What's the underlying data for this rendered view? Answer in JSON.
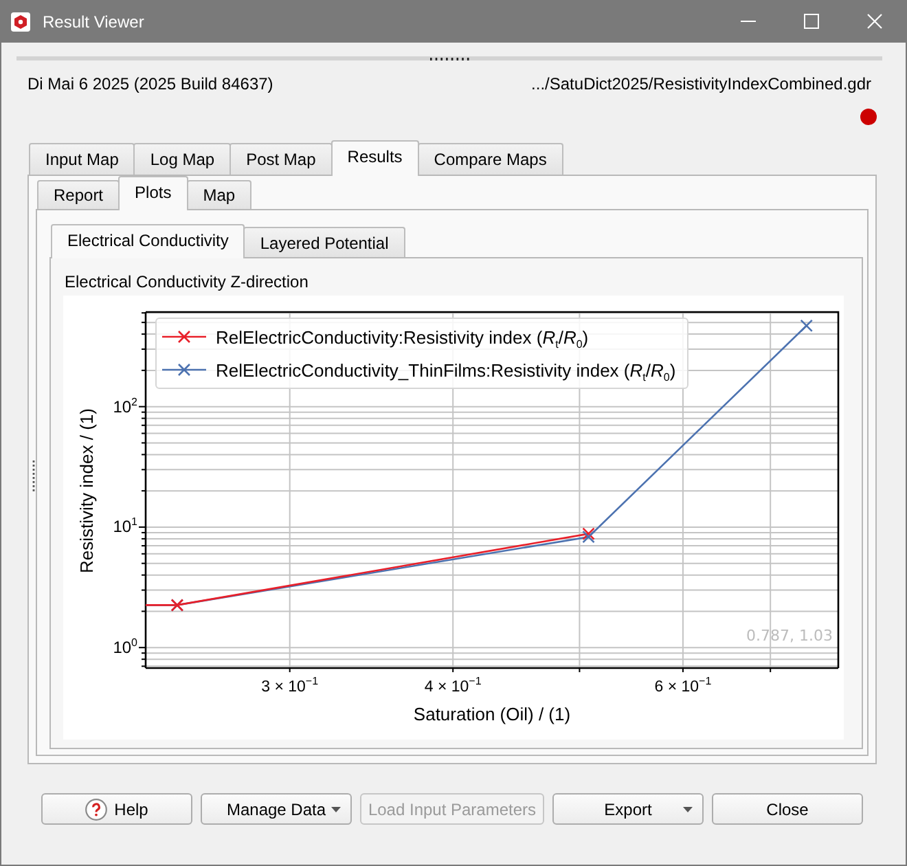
{
  "window": {
    "title": "Result Viewer"
  },
  "header": {
    "build_info": "Di Mai 6 2025 (2025 Build 84637)",
    "file_path": ".../SatuDict2025/ResistivityIndexCombined.gdr"
  },
  "main_tabs": [
    {
      "label": "Input Map",
      "selected": false
    },
    {
      "label": "Log Map",
      "selected": false
    },
    {
      "label": "Post Map",
      "selected": false
    },
    {
      "label": "Results",
      "selected": true
    },
    {
      "label": "Compare Maps",
      "selected": false
    }
  ],
  "sub_tabs": [
    {
      "label": "Report",
      "selected": false
    },
    {
      "label": "Plots",
      "selected": true
    },
    {
      "label": "Map",
      "selected": false
    }
  ],
  "plot_tabs": [
    {
      "label": "Electrical Conductivity",
      "selected": true
    },
    {
      "label": "Layered Potential",
      "selected": false
    }
  ],
  "plot": {
    "title": "Electrical Conductivity Z-direction",
    "legend": [
      {
        "label": "RelElectricConductivity:Resistivity index (*R*$_{t}$/*R*$_{0}$)",
        "color": "#e8202a"
      },
      {
        "label": "RelElectricConductivity_ThinFilms:Resistivity index (*R*$_{t}$/*R*$_{0}$)",
        "color": "#4c72b0"
      }
    ],
    "y_axis": {
      "label": "Resistivity index / (1)",
      "tick_labels": [
        "10$^{2}$",
        "10$^{1}$",
        "10$^{0}$"
      ]
    },
    "x_axis": {
      "label": "Saturation (Oil) / (1)",
      "tick_labels": [
        "3 × 10$^{−1}$",
        "4 × 10$^{−1}$",
        "6 × 10$^{−1}$"
      ]
    },
    "cursor_readout": "0.787, 1.03"
  },
  "buttons": [
    {
      "label": "Help",
      "kind": "help",
      "disabled": false
    },
    {
      "label": "Manage Data",
      "kind": "dropdown",
      "disabled": false
    },
    {
      "label": "Load Input Parameters",
      "kind": "plain",
      "disabled": true
    },
    {
      "label": "Export",
      "kind": "dropdown",
      "disabled": false
    },
    {
      "label": "Close",
      "kind": "plain",
      "disabled": false
    }
  ]
}
